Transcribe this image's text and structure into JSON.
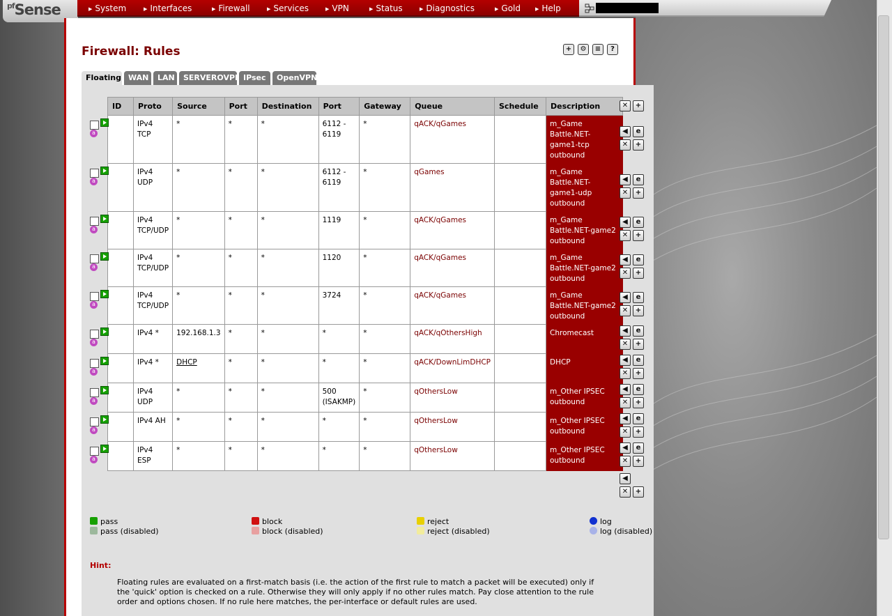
{
  "logo": "Sense",
  "logo_prefix": "pf",
  "menu": [
    {
      "label": "System"
    },
    {
      "label": "Interfaces"
    },
    {
      "label": "Firewall"
    },
    {
      "label": "Services"
    },
    {
      "label": "VPN"
    },
    {
      "label": "Status"
    },
    {
      "label": "Diagnostics"
    },
    {
      "label": "Gold"
    },
    {
      "label": "Help"
    }
  ],
  "page_title": "Firewall: Rules",
  "tabs": [
    {
      "label": "Floating",
      "active": true
    },
    {
      "label": "WAN"
    },
    {
      "label": "LAN"
    },
    {
      "label": "SERVEROVPN"
    },
    {
      "label": "IPsec"
    },
    {
      "label": "OpenVPN"
    }
  ],
  "table": {
    "headers": [
      "ID",
      "Proto",
      "Source",
      "Port",
      "Destination",
      "Port",
      "Gateway",
      "Queue",
      "Schedule",
      "Description"
    ],
    "rows": [
      {
        "id": "",
        "proto": [
          "IPv4",
          "TCP"
        ],
        "source": "*",
        "sport": "*",
        "dest": "*",
        "dport": [
          "6112 -",
          "6119"
        ],
        "gateway": "*",
        "queue": "qACK/qGames",
        "schedule": "",
        "desc": [
          "m_Game",
          "Battle.NET-",
          "game1-tcp",
          "outbound"
        ]
      },
      {
        "id": "",
        "proto": [
          "IPv4",
          "UDP"
        ],
        "source": "*",
        "sport": "*",
        "dest": "*",
        "dport": [
          "6112 -",
          "6119"
        ],
        "gateway": "*",
        "queue": "qGames",
        "schedule": "",
        "desc": [
          "m_Game",
          "Battle.NET-",
          "game1-udp",
          "outbound"
        ]
      },
      {
        "id": "",
        "proto": [
          "IPv4",
          "TCP/UDP"
        ],
        "source": "*",
        "sport": "*",
        "dest": "*",
        "dport": [
          "1119"
        ],
        "gateway": "*",
        "queue": "qACK/qGames",
        "schedule": "",
        "desc": [
          "m_Game",
          "Battle.NET-game2",
          "outbound"
        ]
      },
      {
        "id": "",
        "proto": [
          "IPv4",
          "TCP/UDP"
        ],
        "source": "*",
        "sport": "*",
        "dest": "*",
        "dport": [
          "1120"
        ],
        "gateway": "*",
        "queue": "qACK/qGames",
        "schedule": "",
        "desc": [
          "m_Game",
          "Battle.NET-game2",
          "outbound"
        ]
      },
      {
        "id": "",
        "proto": [
          "IPv4",
          "TCP/UDP"
        ],
        "source": "*",
        "sport": "*",
        "dest": "*",
        "dport": [
          "3724"
        ],
        "gateway": "*",
        "queue": "qACK/qGames",
        "schedule": "",
        "desc": [
          "m_Game",
          "Battle.NET-game2",
          "outbound"
        ]
      },
      {
        "id": "",
        "proto": [
          "IPv4 *"
        ],
        "source": "192.168.1.3",
        "sport": "*",
        "dest": "*",
        "dport": [
          "*"
        ],
        "gateway": "*",
        "queue": "qACK/qOthersHigh",
        "schedule": "",
        "desc": [
          "Chromecast"
        ]
      },
      {
        "id": "",
        "proto": [
          "IPv4 *"
        ],
        "source": "DHCP",
        "source_link": true,
        "sport": "*",
        "dest": "*",
        "dport": [
          "*"
        ],
        "gateway": "*",
        "queue": "qACK/DownLimDHCP",
        "schedule": "",
        "desc": [
          "DHCP"
        ]
      },
      {
        "id": "",
        "proto": [
          "IPv4",
          "UDP"
        ],
        "source": "*",
        "sport": "*",
        "dest": "*",
        "dport": [
          "500",
          "(ISAKMP)"
        ],
        "gateway": "*",
        "queue": "qOthersLow",
        "schedule": "",
        "desc": [
          "m_Other IPSEC",
          "outbound"
        ]
      },
      {
        "id": "",
        "proto": [
          "IPv4 AH"
        ],
        "source": "*",
        "sport": "*",
        "dest": "*",
        "dport": [
          "*"
        ],
        "gateway": "*",
        "queue": "qOthersLow",
        "schedule": "",
        "desc": [
          "m_Other IPSEC",
          "outbound"
        ]
      },
      {
        "id": "",
        "proto": [
          "IPv4 ESP"
        ],
        "source": "*",
        "sport": "*",
        "dest": "*",
        "dport": [
          "*"
        ],
        "gateway": "*",
        "queue": "qOthersLow",
        "schedule": "",
        "desc": [
          "m_Other IPSEC",
          "outbound"
        ]
      }
    ]
  },
  "legend": {
    "pass": "pass",
    "pass_disabled": "pass (disabled)",
    "block": "block",
    "block_disabled": "block (disabled)",
    "reject": "reject",
    "reject_disabled": "reject (disabled)",
    "log": "log",
    "log_disabled": "log (disabled)"
  },
  "hint": {
    "label": "Hint:",
    "text": "Floating rules are evaluated on a first-match basis (i.e. the action of the first rule to match a packet will be executed) only if the 'quick' option is checked on a rule. Otherwise they will only apply if no other rules match. Pay close attention to the rule order and options chosen. If no rule here matches, the per-interface or default rules are used."
  },
  "colors": {
    "brand_red": "#990000",
    "menu_red": "#b40000",
    "queue_text": "#7a0000"
  },
  "icons": {
    "pass": "play-green-icon",
    "advanced": "a-circle-icon",
    "edit": "edit-icon",
    "delete": "delete-x-icon",
    "add": "add-plus-icon",
    "move": "move-arrow-icon"
  }
}
